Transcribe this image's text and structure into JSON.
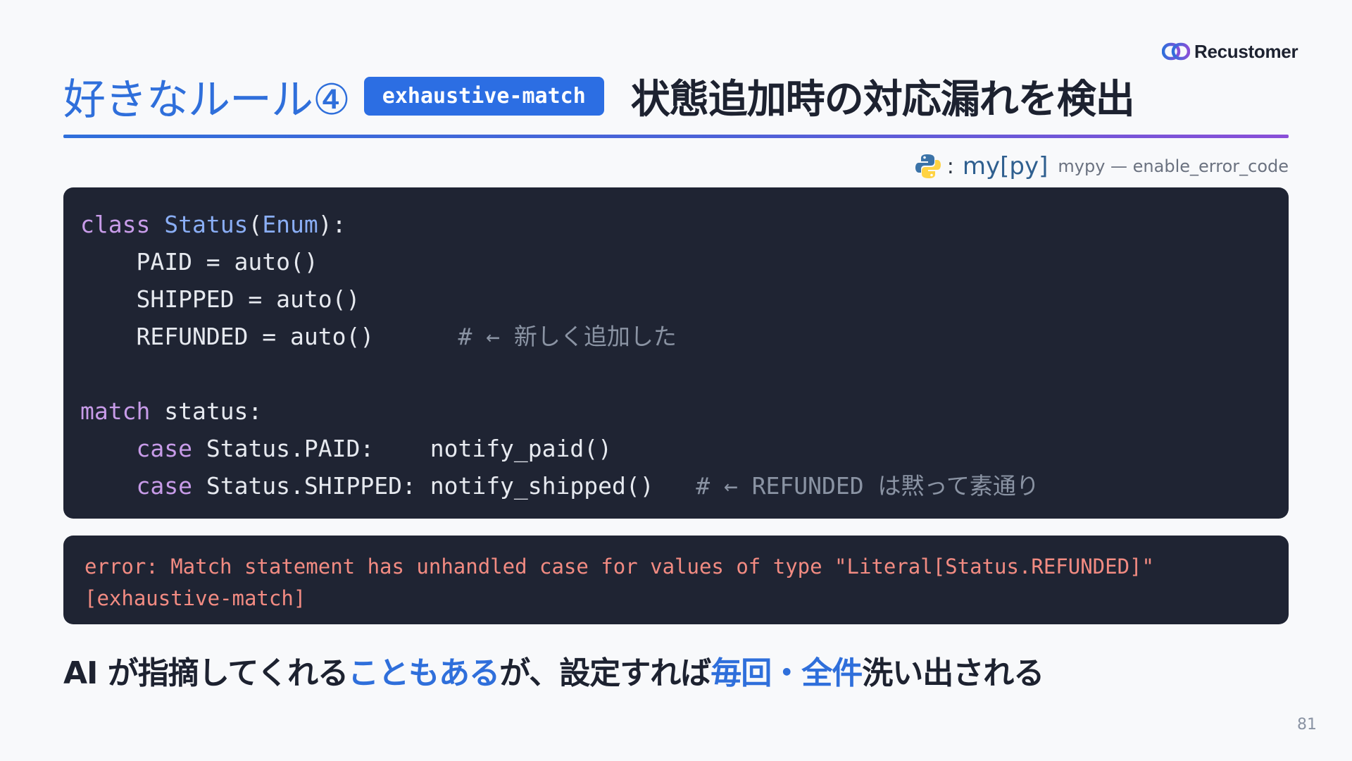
{
  "brand": {
    "name": "Recustomer"
  },
  "title": {
    "lead": "好きなルール④",
    "badge": "exhaustive-match",
    "rest": "状態追加時の対応漏れを検出"
  },
  "source": {
    "colon": ":",
    "logo_a": "my",
    "logo_b": "[py]",
    "note": "mypy — enable_error_code"
  },
  "code": {
    "l1": {
      "kw": "class",
      "cls": "Status",
      "p1": "(",
      "base": "Enum",
      "p2": "):"
    },
    "l2": {
      "text": "    PAID = auto()"
    },
    "l3": {
      "text": "    SHIPPED = auto()"
    },
    "l4": {
      "text": "    REFUNDED = auto()      ",
      "comment": "# ← 新しく追加した"
    },
    "l5": {
      "kw": "match",
      "rest": " status:"
    },
    "l6": {
      "indent": "    ",
      "kw": "case",
      "rest": " Status.PAID:    notify_paid()"
    },
    "l7": {
      "indent": "    ",
      "kw": "case",
      "rest": " Status.SHIPPED: notify_shipped()   ",
      "comment": "# ← REFUNDED は黙って素通り"
    }
  },
  "error": {
    "line1": "error: Match statement has unhandled case for values of type \"Literal[Status.REFUNDED]\"",
    "line2": "[exhaustive-match]"
  },
  "tagline": {
    "p1": "AI が指摘してくれる",
    "h1": "こともある",
    "p2": "が、設定すれば",
    "h2": "毎回・全件",
    "p3": "洗い出される"
  },
  "page": {
    "number": "81"
  },
  "colors": {
    "accent": "#2f6fdb",
    "badge_bg": "#2c6ee3",
    "code_bg": "#1f2433",
    "keyword": "#c79be8",
    "class_name": "#8aaef5",
    "comment": "#8a93a3",
    "error_text": "#f28b82"
  },
  "icons": {
    "brand": "chain-link-logo-icon",
    "source": "python-logo-icon"
  }
}
